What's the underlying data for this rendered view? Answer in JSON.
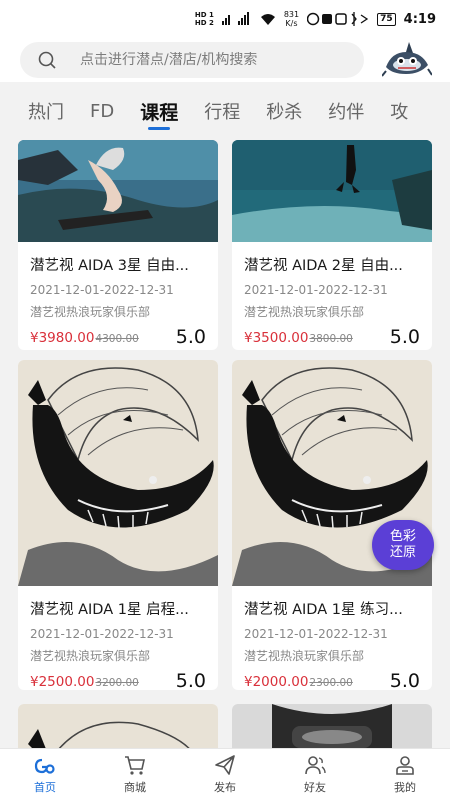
{
  "status_bar": {
    "net1": "HD 1",
    "net2": "HD 2",
    "sig1": "4G",
    "sig2": "5G",
    "speed": "831\nK/s",
    "battery": "75",
    "time": "4:19"
  },
  "search": {
    "placeholder": "点击进行潜点/潜店/机构搜索"
  },
  "tabs": [
    {
      "label": "热门"
    },
    {
      "label": "FD"
    },
    {
      "label": "课程"
    },
    {
      "label": "行程"
    },
    {
      "label": "秒杀"
    },
    {
      "label": "约伴"
    },
    {
      "label": "攻"
    }
  ],
  "cards": [
    {
      "title": "潜艺视 AIDA 3星 自由...",
      "dates": "2021-12-01-2022-12-31",
      "org": "潜艺视热浪玩家俱乐部",
      "price": "¥3980.00",
      "orig_price": "4300.00",
      "rating": "5.0"
    },
    {
      "title": "潜艺视 AIDA 2星 自由...",
      "dates": "2021-12-01-2022-12-31",
      "org": "潜艺视热浪玩家俱乐部",
      "price": "¥3500.00",
      "orig_price": "3800.00",
      "rating": "5.0"
    },
    {
      "title": "潜艺视 AIDA 1星 启程...",
      "dates": "2021-12-01-2022-12-31",
      "org": "潜艺视热浪玩家俱乐部",
      "price": "¥2500.00",
      "orig_price": "3200.00",
      "rating": "5.0"
    },
    {
      "title": "潜艺视 AIDA 1星 练习...",
      "dates": "2021-12-01-2022-12-31",
      "org": "潜艺视热浪玩家俱乐部",
      "price": "¥2000.00",
      "orig_price": "2300.00",
      "rating": "5.0"
    }
  ],
  "float_badge": {
    "line1": "色彩",
    "line2": "还原"
  },
  "bottom_nav": [
    {
      "label": "首页",
      "icon": "home-logo-icon",
      "active": true
    },
    {
      "label": "商城",
      "icon": "cart-icon",
      "active": false
    },
    {
      "label": "发布",
      "icon": "send-icon",
      "active": false
    },
    {
      "label": "好友",
      "icon": "friends-icon",
      "active": false
    },
    {
      "label": "我的",
      "icon": "profile-icon",
      "active": false
    }
  ],
  "colors": {
    "accent": "#1d6fd8",
    "price": "#d9303a",
    "badge": "#5b3fd6"
  }
}
